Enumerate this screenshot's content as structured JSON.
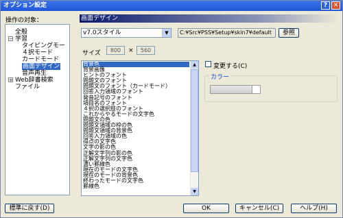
{
  "window": {
    "title": "オプション設定",
    "help_glyph": "?",
    "close_glyph": "✕"
  },
  "target_label": "操作の対象：",
  "section_header": "画面デザイン",
  "tree": {
    "items": [
      {
        "label": "全般",
        "expander": ""
      },
      {
        "label": "学習",
        "expander": "−"
      },
      {
        "label": "タイピングモー",
        "expander": ""
      },
      {
        "label": "４択モード",
        "expander": ""
      },
      {
        "label": "カードモード",
        "expander": ""
      },
      {
        "label": "画面デザイン",
        "expander": ""
      },
      {
        "label": "音声再生",
        "expander": ""
      },
      {
        "label": "Web辞書検索",
        "expander": "+"
      },
      {
        "label": "ファイル",
        "expander": ""
      }
    ]
  },
  "style_select": {
    "value": "v7.0スタイル",
    "arrow": "▼"
  },
  "skin_path": "C:¥Src¥PSS¥Setup¥skin7¥default",
  "browse_button": "参照",
  "size": {
    "label": "サイズ",
    "width": "800",
    "times": "×",
    "height": "560"
  },
  "element_list": [
    "背景色",
    "背景画像",
    "ヒントのフォント",
    "問題文のフォント",
    "問題文のフォント（カードモード）",
    "回答入力領域のフォント",
    "発音記号のフォント",
    "項目名のフォント",
    "４択の選択肢のフォント",
    "これからやるモードの文字色",
    "問題文の色",
    "問題文領域の枠の色",
    "問題文領域の背景色",
    "回答入力領域の色",
    "得点の文字色",
    "文字の影の色",
    "正解文字列の影の色",
    "正解文字列の文字色",
    "濃い罫線色",
    "現在のモードの文字色",
    "現在のモードの背景色",
    "終わったモードの文字色",
    "罫線色"
  ],
  "change_checkbox": "変更する(C)",
  "color_group": "カラー",
  "buttons": {
    "reset": "標準に戻す(D)",
    "ok": "OK",
    "cancel": "キャンセル(C)",
    "help": "ヘルプ(H)"
  },
  "scroll_arrows": {
    "up": "▲",
    "down": "▼"
  }
}
